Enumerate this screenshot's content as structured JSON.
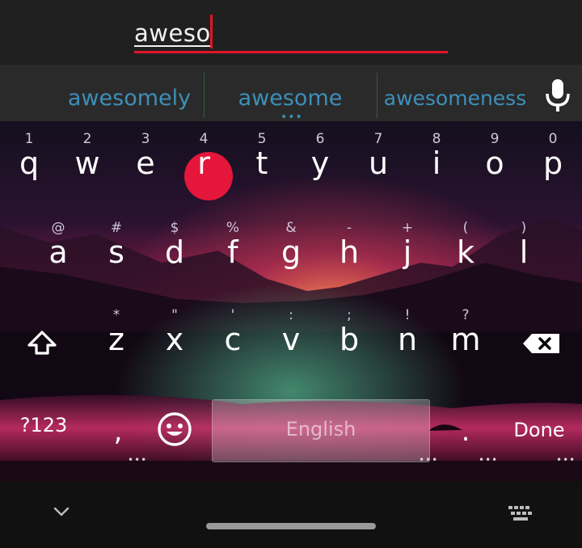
{
  "input": {
    "typed_text": "aweso"
  },
  "suggestions": [
    "awesomely",
    "awesome",
    "awesomeness"
  ],
  "suggestion_more": "•••",
  "keyboard": {
    "row1": [
      {
        "hint": "1",
        "key": "q"
      },
      {
        "hint": "2",
        "key": "w"
      },
      {
        "hint": "3",
        "key": "e"
      },
      {
        "hint": "4",
        "key": "r"
      },
      {
        "hint": "5",
        "key": "t"
      },
      {
        "hint": "6",
        "key": "y"
      },
      {
        "hint": "7",
        "key": "u"
      },
      {
        "hint": "8",
        "key": "i"
      },
      {
        "hint": "9",
        "key": "o"
      },
      {
        "hint": "0",
        "key": "p"
      }
    ],
    "row2": [
      {
        "hint": "@",
        "key": "a"
      },
      {
        "hint": "#",
        "key": "s"
      },
      {
        "hint": "$",
        "key": "d"
      },
      {
        "hint": "%",
        "key": "f"
      },
      {
        "hint": "&",
        "key": "g"
      },
      {
        "hint": "-",
        "key": "h"
      },
      {
        "hint": "+",
        "key": "j"
      },
      {
        "hint": "(",
        "key": "k"
      },
      {
        "hint": ")",
        "key": "l"
      }
    ],
    "row3": [
      {
        "hint": "*",
        "key": "z"
      },
      {
        "hint": "\"",
        "key": "x"
      },
      {
        "hint": "'",
        "key": "c"
      },
      {
        "hint": ":",
        "key": "v"
      },
      {
        "hint": ";",
        "key": "b"
      },
      {
        "hint": "!",
        "key": "n"
      },
      {
        "hint": "?",
        "key": "m"
      }
    ],
    "symbols_label": "?123",
    "comma": ",",
    "space_label": "English",
    "period": ".",
    "done_label": "Done"
  },
  "colors": {
    "accent_red": "#e3142a",
    "suggestion_blue": "#3d8fb8"
  }
}
